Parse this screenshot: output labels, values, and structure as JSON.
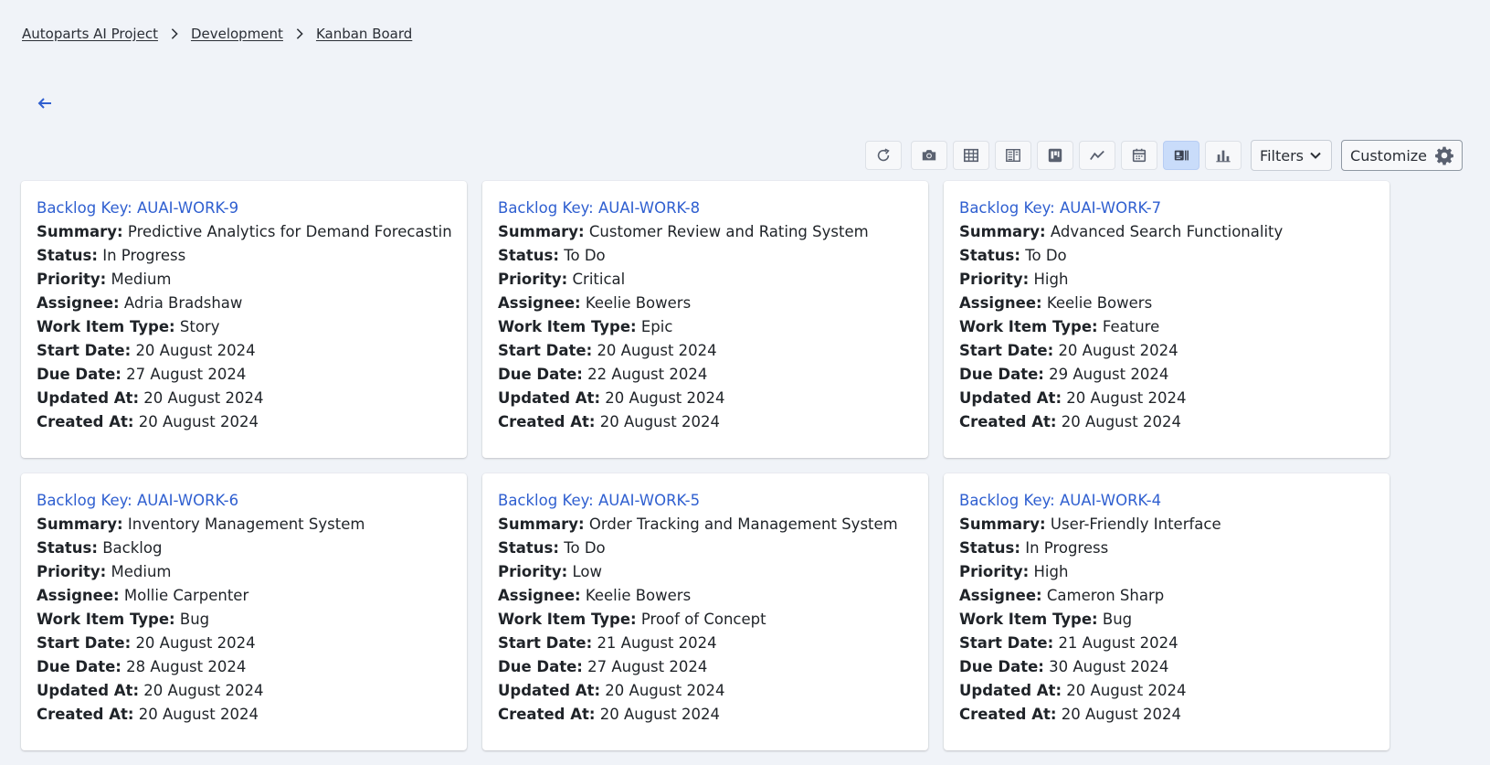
{
  "breadcrumb": {
    "items": [
      "Autoparts AI Project",
      "Development",
      "Kanban Board"
    ]
  },
  "toolbar": {
    "buttons": [
      {
        "icon": "refresh-icon"
      },
      {
        "icon": "camera-icon"
      },
      {
        "icon": "table-icon"
      },
      {
        "icon": "list-view-icon"
      },
      {
        "icon": "kanban-icon"
      },
      {
        "icon": "line-chart-icon"
      },
      {
        "icon": "calendar-icon"
      },
      {
        "icon": "card-view-icon",
        "active": true
      },
      {
        "icon": "bar-chart-icon"
      }
    ],
    "filters_label": "Filters",
    "customize_label": "Customize",
    "accent_color": "#c9dcfa"
  },
  "labels": {
    "backlog_key": "Backlog Key:",
    "summary": "Summary:",
    "status": "Status:",
    "priority": "Priority:",
    "assignee": "Assignee:",
    "work_item_type": "Work Item Type:",
    "start_date": "Start Date:",
    "due_date": "Due Date:",
    "updated_at": "Updated At:",
    "created_at": "Created At:"
  },
  "cards": [
    {
      "backlog_key": "AUAI-WORK-9",
      "summary": "Predictive Analytics for Demand Forecasting",
      "status": "In Progress",
      "priority": "Medium",
      "assignee": "Adria Bradshaw",
      "work_item_type": "Story",
      "start_date": "20 August 2024",
      "due_date": "27 August 2024",
      "updated_at": "20 August 2024",
      "created_at": "20 August 2024"
    },
    {
      "backlog_key": "AUAI-WORK-8",
      "summary": "Customer Review and Rating System",
      "status": "To Do",
      "priority": "Critical",
      "assignee": "Keelie Bowers",
      "work_item_type": "Epic",
      "start_date": "20 August 2024",
      "due_date": "22 August 2024",
      "updated_at": "20 August 2024",
      "created_at": "20 August 2024"
    },
    {
      "backlog_key": "AUAI-WORK-7",
      "summary": "Advanced Search Functionality",
      "status": "To Do",
      "priority": "High",
      "assignee": "Keelie Bowers",
      "work_item_type": "Feature",
      "start_date": "20 August 2024",
      "due_date": "29 August 2024",
      "updated_at": "20 August 2024",
      "created_at": "20 August 2024"
    },
    {
      "backlog_key": "AUAI-WORK-6",
      "summary": "Inventory Management System",
      "status": "Backlog",
      "priority": "Medium",
      "assignee": "Mollie Carpenter",
      "work_item_type": "Bug",
      "start_date": "20 August 2024",
      "due_date": "28 August 2024",
      "updated_at": "20 August 2024",
      "created_at": "20 August 2024"
    },
    {
      "backlog_key": "AUAI-WORK-5",
      "summary": "Order Tracking and Management System",
      "status": "To Do",
      "priority": "Low",
      "assignee": "Keelie Bowers",
      "work_item_type": "Proof of Concept",
      "start_date": "21 August 2024",
      "due_date": "27 August 2024",
      "updated_at": "20 August 2024",
      "created_at": "20 August 2024"
    },
    {
      "backlog_key": "AUAI-WORK-4",
      "summary": "User-Friendly Interface",
      "status": "In Progress",
      "priority": "High",
      "assignee": "Cameron Sharp",
      "work_item_type": "Bug",
      "start_date": "21 August 2024",
      "due_date": "30 August 2024",
      "updated_at": "20 August 2024",
      "created_at": "20 August 2024"
    }
  ]
}
